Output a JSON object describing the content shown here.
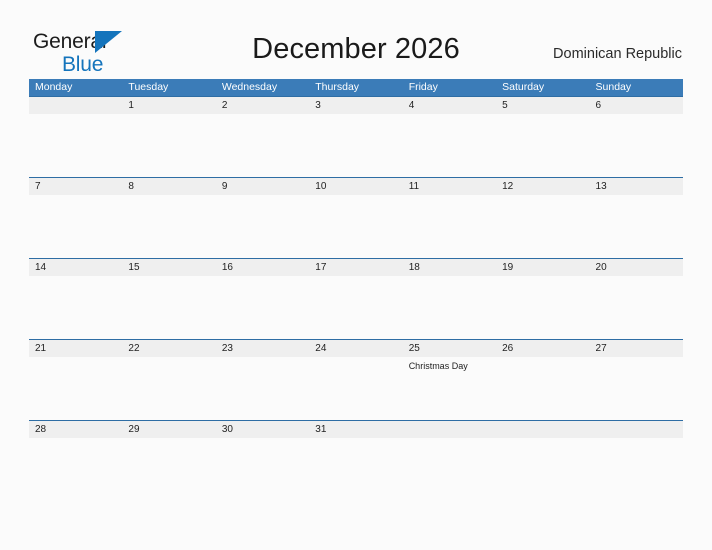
{
  "brand": {
    "word1": "General",
    "word2": "Blue",
    "triangle_icon": "brand-triangle-icon",
    "accent_color": "#1474bc"
  },
  "header": {
    "title": "December 2026",
    "region": "Dominican Republic"
  },
  "theme": {
    "header_blue": "#3b7cb8",
    "row_divider_blue": "#2e6da4",
    "date_band_gray": "#efefef",
    "page_background": "#fbfbfb"
  },
  "calendar": {
    "weekdays": [
      "Monday",
      "Tuesday",
      "Wednesday",
      "Thursday",
      "Friday",
      "Saturday",
      "Sunday"
    ],
    "weeks": [
      [
        {
          "day": "",
          "event": ""
        },
        {
          "day": "1",
          "event": ""
        },
        {
          "day": "2",
          "event": ""
        },
        {
          "day": "3",
          "event": ""
        },
        {
          "day": "4",
          "event": ""
        },
        {
          "day": "5",
          "event": ""
        },
        {
          "day": "6",
          "event": ""
        }
      ],
      [
        {
          "day": "7",
          "event": ""
        },
        {
          "day": "8",
          "event": ""
        },
        {
          "day": "9",
          "event": ""
        },
        {
          "day": "10",
          "event": ""
        },
        {
          "day": "11",
          "event": ""
        },
        {
          "day": "12",
          "event": ""
        },
        {
          "day": "13",
          "event": ""
        }
      ],
      [
        {
          "day": "14",
          "event": ""
        },
        {
          "day": "15",
          "event": ""
        },
        {
          "day": "16",
          "event": ""
        },
        {
          "day": "17",
          "event": ""
        },
        {
          "day": "18",
          "event": ""
        },
        {
          "day": "19",
          "event": ""
        },
        {
          "day": "20",
          "event": ""
        }
      ],
      [
        {
          "day": "21",
          "event": ""
        },
        {
          "day": "22",
          "event": ""
        },
        {
          "day": "23",
          "event": ""
        },
        {
          "day": "24",
          "event": ""
        },
        {
          "day": "25",
          "event": "Christmas Day"
        },
        {
          "day": "26",
          "event": ""
        },
        {
          "day": "27",
          "event": ""
        }
      ],
      [
        {
          "day": "28",
          "event": ""
        },
        {
          "day": "29",
          "event": ""
        },
        {
          "day": "30",
          "event": ""
        },
        {
          "day": "31",
          "event": ""
        },
        {
          "day": "",
          "event": ""
        },
        {
          "day": "",
          "event": ""
        },
        {
          "day": "",
          "event": ""
        }
      ]
    ]
  }
}
